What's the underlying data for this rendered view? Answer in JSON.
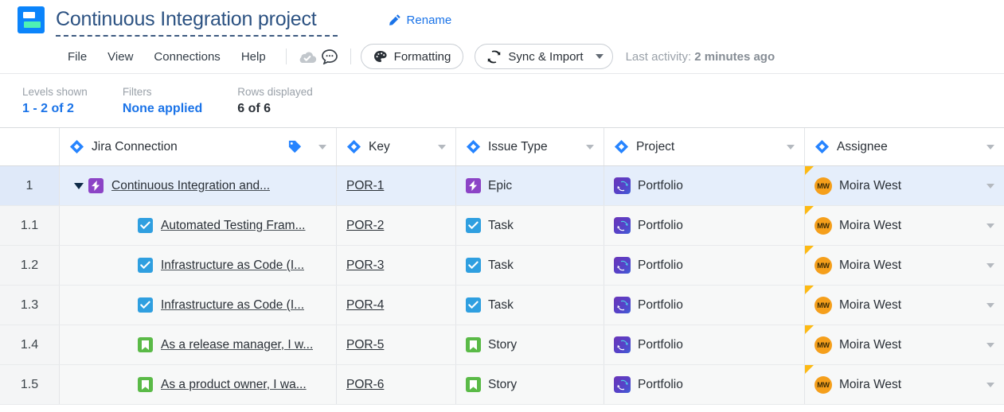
{
  "titlebar": {
    "logo_name": "app-logo",
    "project_title": "Continuous Integration project",
    "rename_label": "Rename"
  },
  "menubar": {
    "items": [
      "File",
      "View",
      "Connections",
      "Help"
    ],
    "cloud_icon": "cloud-check-icon",
    "comment_icon": "comment-bubble-icon",
    "formatting_label": "Formatting",
    "formatting_icon": "palette-icon",
    "sync_label": "Sync & Import",
    "sync_icon": "sync-refresh-icon",
    "last_activity_label": "Last activity:",
    "last_activity_value": "2 minutes ago"
  },
  "stats": [
    {
      "label": "Levels shown",
      "value": "1 - 2 of 2",
      "style": "link"
    },
    {
      "label": "Filters",
      "value": "None applied",
      "style": "link"
    },
    {
      "label": "Rows displayed",
      "value": "6 of 6",
      "style": "plain"
    }
  ],
  "table": {
    "columns": [
      {
        "key": "num",
        "label": "",
        "icon": ""
      },
      {
        "key": "name",
        "label": "Jira Connection",
        "icon": "jira-diamond-icon"
      },
      {
        "key": "key",
        "label": "Key",
        "icon": "jira-diamond-icon"
      },
      {
        "key": "type",
        "label": "Issue Type",
        "icon": "jira-diamond-icon"
      },
      {
        "key": "proj",
        "label": "Project",
        "icon": "jira-diamond-icon"
      },
      {
        "key": "assign",
        "label": "Assignee",
        "icon": "jira-diamond-icon"
      }
    ],
    "rows": [
      {
        "num": "1",
        "name": "Continuous Integration and...",
        "type_icon": "epic",
        "key": "POR-1",
        "type": "Epic",
        "project": "Portfolio",
        "assignee": "Moira West",
        "initials": "MW",
        "indent": 0,
        "expanded": true,
        "selected": true
      },
      {
        "num": "1.1",
        "name": "Automated Testing Fram...",
        "type_icon": "task",
        "key": "POR-2",
        "type": "Task",
        "project": "Portfolio",
        "assignee": "Moira West",
        "initials": "MW",
        "indent": 1,
        "expanded": false,
        "selected": false
      },
      {
        "num": "1.2",
        "name": "Infrastructure as Code (I...",
        "type_icon": "task",
        "key": "POR-3",
        "type": "Task",
        "project": "Portfolio",
        "assignee": "Moira West",
        "initials": "MW",
        "indent": 1,
        "expanded": false,
        "selected": false
      },
      {
        "num": "1.3",
        "name": "Infrastructure as Code (I...",
        "type_icon": "task",
        "key": "POR-4",
        "type": "Task",
        "project": "Portfolio",
        "assignee": "Moira West",
        "initials": "MW",
        "indent": 1,
        "expanded": false,
        "selected": false
      },
      {
        "num": "1.4",
        "name": "As a release manager, I w...",
        "type_icon": "story",
        "key": "POR-5",
        "type": "Story",
        "project": "Portfolio",
        "assignee": "Moira West",
        "initials": "MW",
        "indent": 1,
        "expanded": false,
        "selected": false
      },
      {
        "num": "1.5",
        "name": "As a product owner, I wa...",
        "type_icon": "story",
        "key": "POR-6",
        "type": "Story",
        "project": "Portfolio",
        "assignee": "Moira West",
        "initials": "MW",
        "indent": 1,
        "expanded": false,
        "selected": false
      }
    ]
  },
  "colors": {
    "accent_blue": "#1a73e8",
    "logo_blue": "#0b84fb",
    "logo_green": "#4ef0b4",
    "epic_purple": "#8c44c6",
    "task_blue": "#2f9fe0",
    "story_green": "#5aba47",
    "avatar_orange": "#f59f1b",
    "flag_yellow": "#fdb913",
    "row_selected": "#e5eefb"
  }
}
